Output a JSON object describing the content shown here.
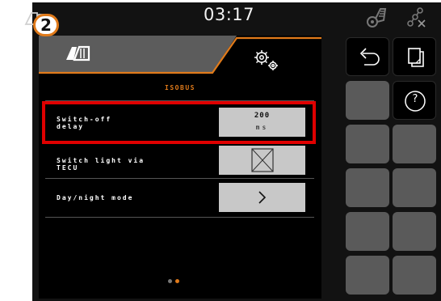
{
  "status_bar": {
    "clock": "03:17",
    "step_number": "2"
  },
  "tabs": [
    {
      "name": "machine-tab",
      "icon": "machine-icon",
      "active": false
    },
    {
      "name": "settings-tab",
      "icon": "gears-icon",
      "active": true
    }
  ],
  "section_title": "ISOBUS",
  "settings": [
    {
      "label": "Switch-off\ndelay",
      "value": "200",
      "unit": "ms",
      "highlighted": true
    },
    {
      "label": "Switch light via\nTECU",
      "control": "checkbox",
      "checked": false
    },
    {
      "label": "Day/night mode",
      "control": "chevron-right-icon"
    }
  ],
  "pager": {
    "count": 2,
    "active_index": 1
  },
  "softkeys": {
    "back": "back-arrow-icon",
    "pages": "page-switch-icon",
    "help": "?"
  },
  "colors": {
    "accent": "#e07a1a",
    "highlight": "#e00000",
    "button_grey": "#5a5a5a",
    "value_button": "#c8c8c8"
  }
}
